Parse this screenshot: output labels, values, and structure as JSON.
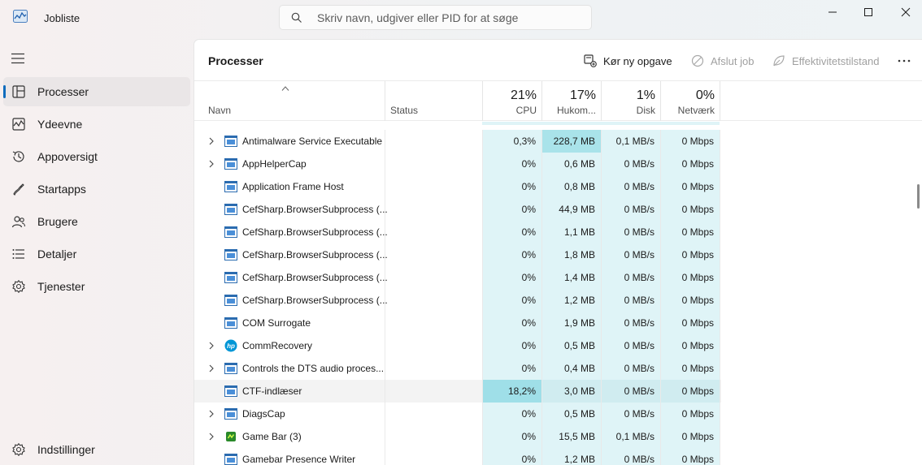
{
  "window": {
    "title": "Jobliste",
    "search_placeholder": "Skriv navn, udgiver eller PID for at søge"
  },
  "sidebar": {
    "items": [
      {
        "label": "Processer",
        "icon": "processes-icon",
        "active": true
      },
      {
        "label": "Ydeevne",
        "icon": "performance-icon",
        "active": false
      },
      {
        "label": "Appoversigt",
        "icon": "app-history-icon",
        "active": false
      },
      {
        "label": "Startapps",
        "icon": "startup-apps-icon",
        "active": false
      },
      {
        "label": "Brugere",
        "icon": "users-icon",
        "active": false
      },
      {
        "label": "Detaljer",
        "icon": "details-icon",
        "active": false
      },
      {
        "label": "Tjenester",
        "icon": "services-icon",
        "active": false
      }
    ],
    "settings_label": "Indstillinger"
  },
  "toolbar": {
    "page_title": "Processer",
    "run_new_task": "Kør ny opgave",
    "end_task": "Afslut job",
    "efficiency_mode": "Effektivitetstilstand"
  },
  "columns": {
    "name": "Navn",
    "status": "Status",
    "cpu_pct": "21%",
    "cpu": "CPU",
    "mem_pct": "17%",
    "mem": "Hukom...",
    "disk_pct": "1%",
    "disk": "Disk",
    "net_pct": "0%",
    "net": "Netværk"
  },
  "rows": [
    {
      "name": "Antimalware Service Executable",
      "expandable": true,
      "icon": "app-window-icon",
      "cpu": "0,3%",
      "mem": "228,7 MB",
      "disk": "0,1 MB/s",
      "net": "0 Mbps"
    },
    {
      "name": "AppHelperCap",
      "expandable": true,
      "icon": "app-window-icon",
      "cpu": "0%",
      "mem": "0,6 MB",
      "disk": "0 MB/s",
      "net": "0 Mbps"
    },
    {
      "name": "Application Frame Host",
      "expandable": false,
      "icon": "app-window-icon",
      "cpu": "0%",
      "mem": "0,8 MB",
      "disk": "0 MB/s",
      "net": "0 Mbps"
    },
    {
      "name": "CefSharp.BrowserSubprocess (...",
      "expandable": false,
      "icon": "app-window-icon",
      "cpu": "0%",
      "mem": "44,9 MB",
      "disk": "0 MB/s",
      "net": "0 Mbps"
    },
    {
      "name": "CefSharp.BrowserSubprocess (...",
      "expandable": false,
      "icon": "app-window-icon",
      "cpu": "0%",
      "mem": "1,1 MB",
      "disk": "0 MB/s",
      "net": "0 Mbps"
    },
    {
      "name": "CefSharp.BrowserSubprocess (...",
      "expandable": false,
      "icon": "app-window-icon",
      "cpu": "0%",
      "mem": "1,8 MB",
      "disk": "0 MB/s",
      "net": "0 Mbps"
    },
    {
      "name": "CefSharp.BrowserSubprocess (...",
      "expandable": false,
      "icon": "app-window-icon",
      "cpu": "0%",
      "mem": "1,4 MB",
      "disk": "0 MB/s",
      "net": "0 Mbps"
    },
    {
      "name": "CefSharp.BrowserSubprocess (...",
      "expandable": false,
      "icon": "app-window-icon",
      "cpu": "0%",
      "mem": "1,2 MB",
      "disk": "0 MB/s",
      "net": "0 Mbps"
    },
    {
      "name": "COM Surrogate",
      "expandable": false,
      "icon": "app-window-icon",
      "cpu": "0%",
      "mem": "1,9 MB",
      "disk": "0 MB/s",
      "net": "0 Mbps"
    },
    {
      "name": "CommRecovery",
      "expandable": true,
      "icon": "hp-logo-icon",
      "cpu": "0%",
      "mem": "0,5 MB",
      "disk": "0 MB/s",
      "net": "0 Mbps"
    },
    {
      "name": "Controls the DTS audio proces...",
      "expandable": true,
      "icon": "app-window-icon",
      "cpu": "0%",
      "mem": "0,4 MB",
      "disk": "0 MB/s",
      "net": "0 Mbps"
    },
    {
      "name": "CTF-indlæser",
      "expandable": false,
      "icon": "app-window-icon",
      "cpu": "18,2%",
      "mem": "3,0 MB",
      "disk": "0 MB/s",
      "net": "0 Mbps",
      "highlight": true
    },
    {
      "name": "DiagsCap",
      "expandable": true,
      "icon": "app-window-icon",
      "cpu": "0%",
      "mem": "0,5 MB",
      "disk": "0 MB/s",
      "net": "0 Mbps"
    },
    {
      "name": "Game Bar (3)",
      "expandable": true,
      "icon": "game-bar-icon",
      "cpu": "0%",
      "mem": "15,5 MB",
      "disk": "0,1 MB/s",
      "net": "0 Mbps"
    },
    {
      "name": "Gamebar Presence Writer",
      "expandable": false,
      "icon": "app-window-icon",
      "cpu": "0%",
      "mem": "1,2 MB",
      "disk": "0 MB/s",
      "net": "0 Mbps"
    }
  ]
}
